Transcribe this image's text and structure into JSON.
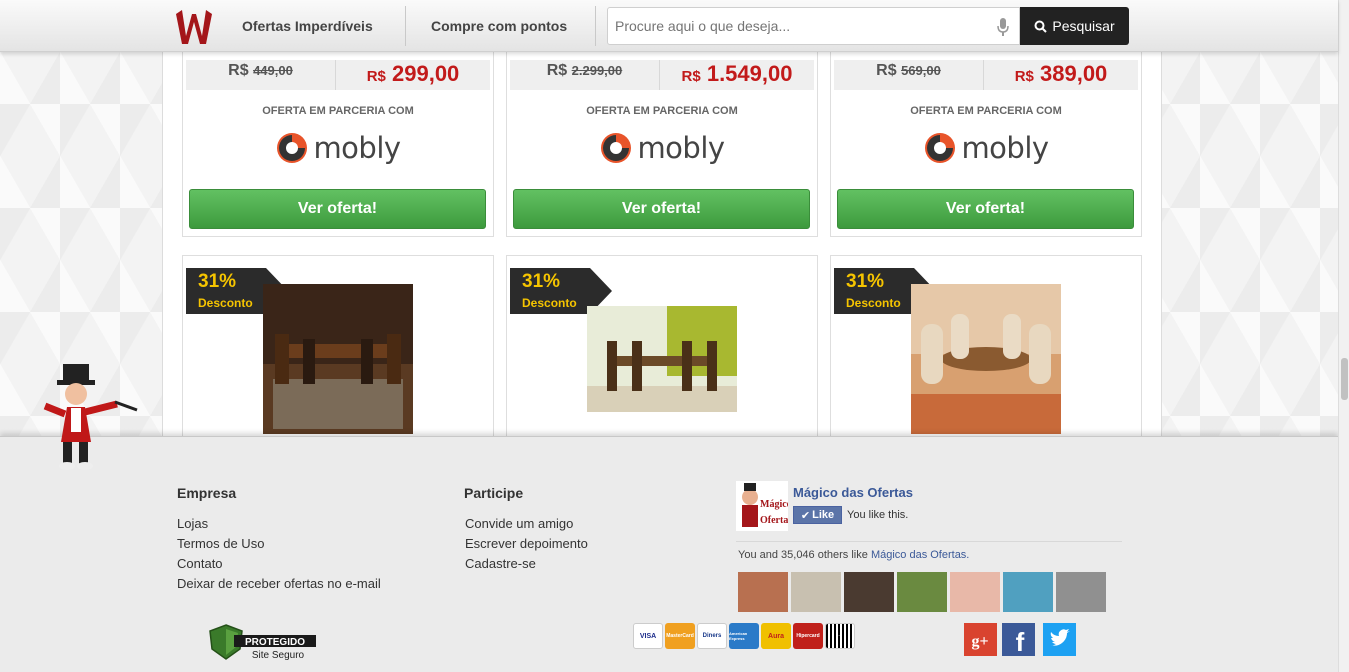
{
  "header": {
    "nav": [
      "Ofertas Imperdíveis",
      "Compre com pontos"
    ],
    "search_placeholder": "Procure aqui o que deseja...",
    "search_button": "Pesquisar"
  },
  "offers_top": [
    {
      "currency": "R$",
      "old_price": "449,00",
      "new_price": "299,00",
      "partner_label": "OFERTA EM PARCERIA COM",
      "brand": "mobly",
      "button": "Ver oferta!"
    },
    {
      "currency": "R$",
      "old_price": "2.299,00",
      "new_price": "1.549,00",
      "partner_label": "OFERTA EM PARCERIA COM",
      "brand": "mobly",
      "button": "Ver oferta!"
    },
    {
      "currency": "R$",
      "old_price": "569,00",
      "new_price": "389,00",
      "partner_label": "OFERTA EM PARCERIA COM",
      "brand": "mobly",
      "button": "Ver oferta!"
    }
  ],
  "offers_bottom": [
    {
      "discount": "31%",
      "discount_label": "Desconto"
    },
    {
      "discount": "31%",
      "discount_label": "Desconto"
    },
    {
      "discount": "31%",
      "discount_label": "Desconto"
    }
  ],
  "footer": {
    "col1": {
      "title": "Empresa",
      "links": [
        "Lojas",
        "Termos de Uso",
        "Contato",
        "Deixar de receber ofertas no e-mail"
      ]
    },
    "col2": {
      "title": "Participe",
      "links": [
        "Convide um amigo",
        "Escrever depoimento",
        "Cadastre-se"
      ]
    },
    "facebook": {
      "page_name": "Mágico das Ofertas",
      "like_button": "Like",
      "you_like": "You like this.",
      "count_text": "You and 35,046 others like",
      "count_link": "Mágico das Ofertas."
    },
    "seal": {
      "title": "PROTEGIDO",
      "subtitle": "Site Seguro"
    },
    "payment_cards": [
      "VISA",
      "MasterCard",
      "Diners",
      "American Express",
      "Aura",
      "Hipercard",
      "Boleto"
    ],
    "social": [
      "google-plus",
      "facebook",
      "twitter"
    ]
  },
  "colors": {
    "price_red": "#c21a1a",
    "offer_green": "#4cae4c",
    "badge_yellow": "#f5c400",
    "fb_blue": "#3b5998"
  }
}
